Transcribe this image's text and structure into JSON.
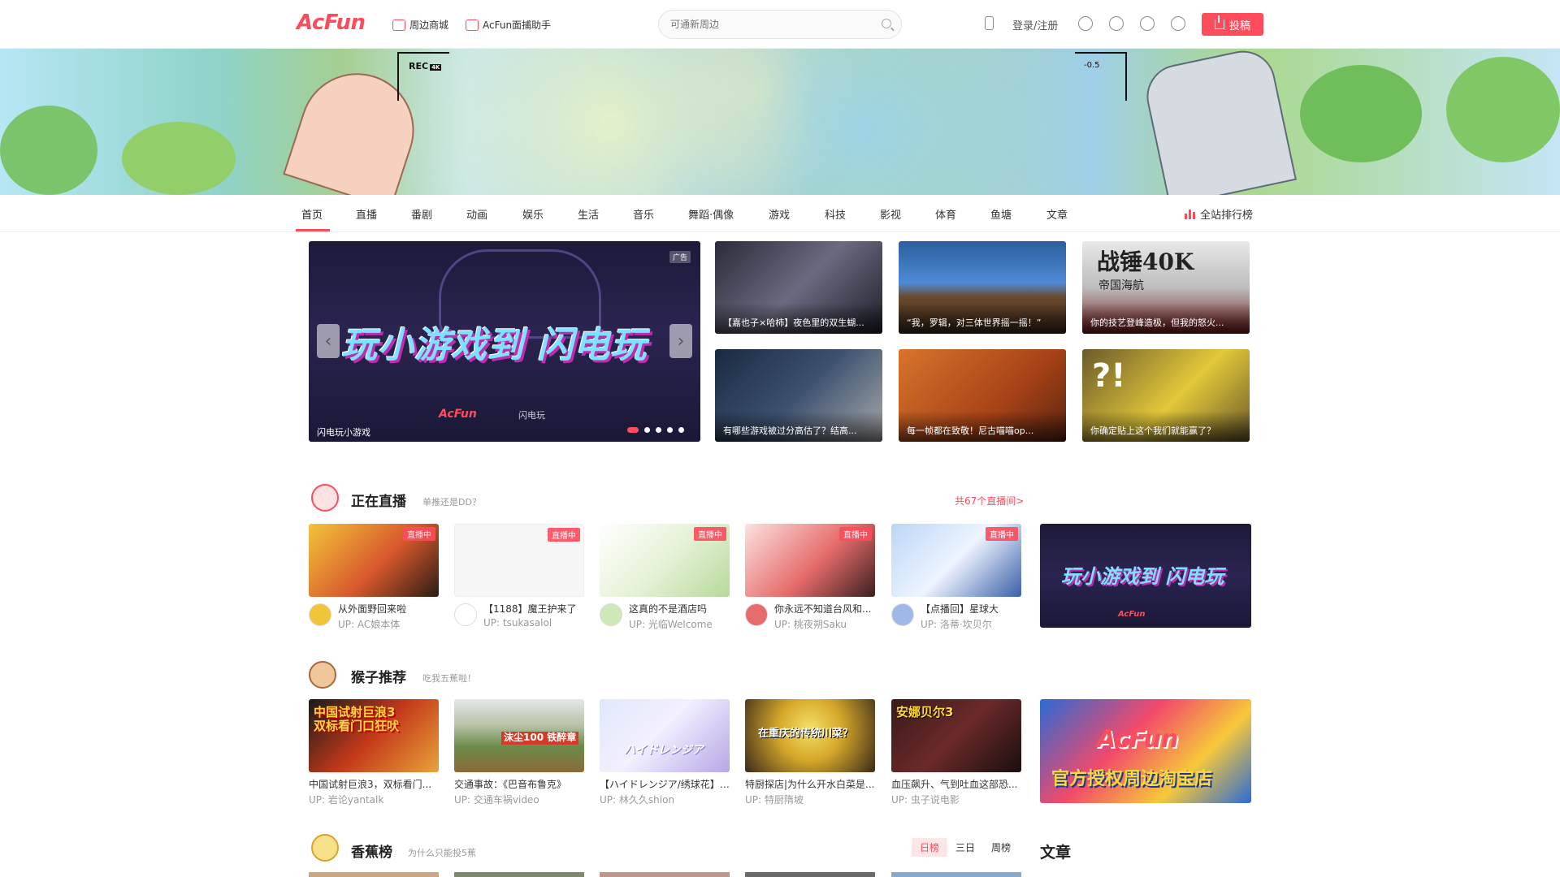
{
  "header": {
    "logo": "AcFun",
    "links": [
      "周边商城",
      "AcFun面捕助手"
    ],
    "search_placeholder": "可通新周边",
    "login": "登录/注册",
    "upload": "投稿"
  },
  "banner": {
    "rec": "REC",
    "rec_badge": "4K",
    "ev": "-0.5"
  },
  "categories": [
    "首页",
    "直播",
    "番剧",
    "动画",
    "娱乐",
    "生活",
    "音乐",
    "舞蹈·偶像",
    "游戏",
    "科技",
    "影视",
    "体育",
    "鱼塘",
    "文章"
  ],
  "rank_label": "全站排行榜",
  "hero": {
    "title": "玩小游戏到 闪电玩",
    "caption": "闪电玩小游戏",
    "ad": "广告",
    "brand": "AcFun",
    "brand2": "闪电玩"
  },
  "thumbs": [
    "【嘉也子×哈柿】夜色里的双生蝴...",
    "“我，罗辑，对三体世界摇一摇！”",
    "你的技艺登峰造极，但我的怒火...",
    "有哪些游戏被过分高估了？结高...",
    "每一帧都在致敬！尼古喵喵op...",
    "你确定贴上这个我们就能赢了？"
  ],
  "thumb_overlay": {
    "t3_big": "战锤40K",
    "t3_small": "帝国海航"
  },
  "live": {
    "title": "正在直播",
    "sub": "单推还是DD？",
    "more": "共67个直播间>",
    "tag": "直播中",
    "cards": [
      {
        "title": "从外面野回来啦",
        "up": "UP:  AC娘本体"
      },
      {
        "title": "【1188】魔王护来了",
        "up": "UP:  tsukasalol"
      },
      {
        "title": "这真的不是酒店吗",
        "up": "UP:  光临Welcome"
      },
      {
        "title": "你永远不知道台风和...",
        "up": "UP:  桃夜朔Saku"
      },
      {
        "title": "【点播回】星球大",
        "up": "UP:  洛蒂·坎贝尔"
      }
    ]
  },
  "monkey": {
    "title": "猴子推荐",
    "sub": "吃我五蕉啦！",
    "cards": [
      {
        "title": "中国试射巨浪3，双标看门...",
        "up": "UP:  岩论yantalk",
        "img_text": "中国试射巨浪3 双标看门口狂吠"
      },
      {
        "title": "交通事故：《巴音布鲁克》",
        "up": "UP:  交通车祸video",
        "img_text": "沫尘100 铁醉章"
      },
      {
        "title": "【ハイドレンジア/绣球花】c...",
        "up": "UP:  林久久shion",
        "img_text": "ハイドレンジア"
      },
      {
        "title": "特厨探店|为什么开水白菜是...",
        "up": "UP:  特厨隋坡",
        "img_text": "在重庆的传统川菜？"
      },
      {
        "title": "血压飙升、气到吐血这部恐...",
        "up": "UP:  虫子说电影",
        "img_text": "安娜贝尔3"
      }
    ],
    "promo": "官方授权周边淘宝店"
  },
  "banana": {
    "title": "香蕉榜",
    "sub": "为什么只能投5蕉",
    "tabs": [
      "日榜",
      "三日",
      "周榜"
    ]
  },
  "article_title": "文章",
  "colors": {
    "accent": "#fd4c5c"
  }
}
